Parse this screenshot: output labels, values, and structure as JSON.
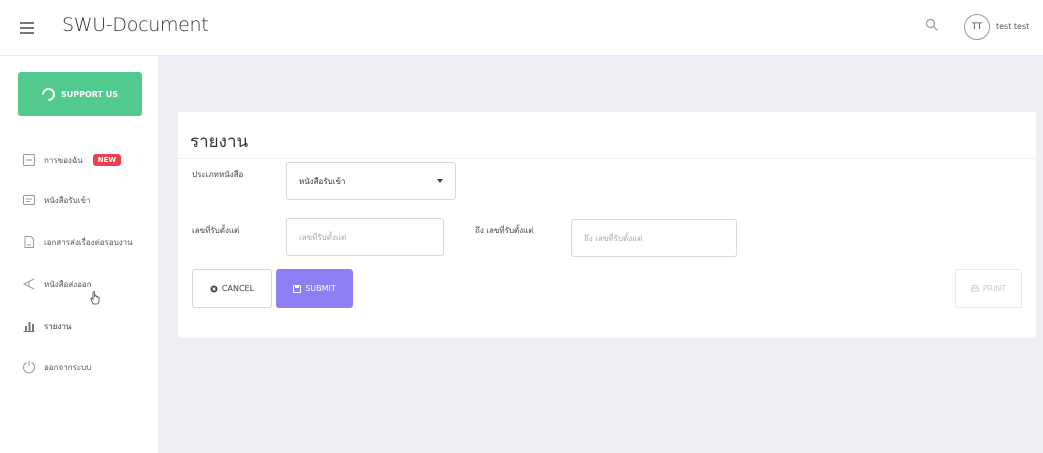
{
  "topbar": {
    "app_title": "SWU-Document",
    "avatar_initials": "TT",
    "username": "test test",
    "icons": [
      "menu-icon",
      "search-icon"
    ]
  },
  "sidebar": {
    "support_label": "SUPPORT US",
    "items": [
      {
        "label": "การของฉัน",
        "icon": "list-icon",
        "badge": "NEW"
      },
      {
        "label": "หนังสือรับเข้า",
        "icon": "inbox-icon"
      },
      {
        "label": "เอกสารส่งเรื่องต่อรอบงาน",
        "icon": "document-icon"
      },
      {
        "label": "หนังสือส่งออก",
        "icon": "send-icon"
      },
      {
        "label": "รายงาน",
        "icon": "chart-icon",
        "active": true
      },
      {
        "label": "ออกจากระบบ",
        "icon": "logout-icon"
      }
    ]
  },
  "report": {
    "title": "รายงาน",
    "doc_type_label": "ประเภทหนังสือ",
    "doc_type_value": "หนังสือรับเข้า",
    "from_label": "เลขที่รับตั้งแต่",
    "from_placeholder": "เลขที่รับตั้งแต่",
    "to_label": "ถึง เลขที่รับตั้งแต่",
    "to_placeholder": "ถึง เลขที่รับตั้งแต่",
    "cancel_label": "CANCEL",
    "submit_label": "SUBMIT",
    "print_label": "PRINT"
  },
  "colors": {
    "support_green": "#52c98f",
    "submit_purple": "#8d7ef4",
    "badge_red": "#e8424c",
    "page_bg": "#edeff4"
  }
}
